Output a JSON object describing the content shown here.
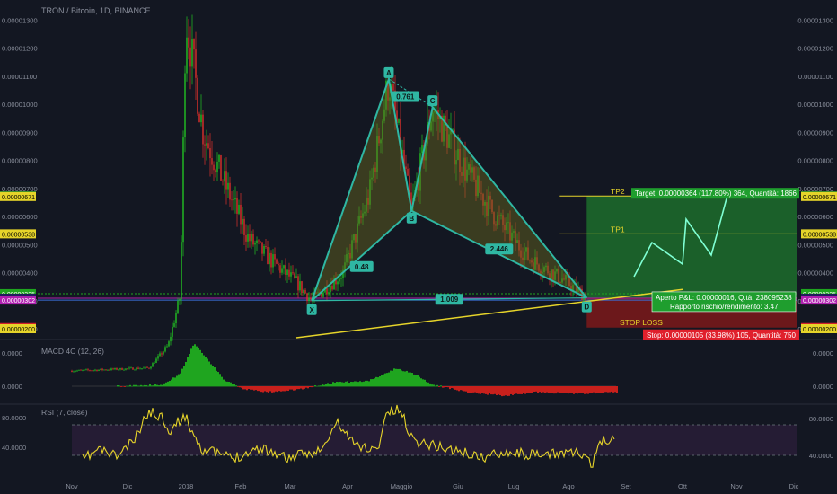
{
  "header": {
    "title": "TRON / Bitcoin, 1D, BINANCE"
  },
  "colors": {
    "bg": "#131722",
    "up": "#26a69a",
    "upBright": "#22c322",
    "down": "#e0312b",
    "pattern": "#2fb7a3",
    "patternFill": "#6b6b1e",
    "trend": "#e6d42a",
    "macdUp": "#1fa51f",
    "macdDown": "#c8201c",
    "rsi": "#e6d42a",
    "target": "#1f7a2e",
    "stop": "#8b1a1a"
  },
  "price_axis": {
    "labels": [
      "0.00001300",
      "0.00001200",
      "0.00001100",
      "0.00001000",
      "0.00000900",
      "0.00000800",
      "0.00000700",
      "0.00000600",
      "0.00000500",
      "0.00000400",
      "0.00000300",
      "0.00000200"
    ]
  },
  "price_tags": [
    {
      "value": "0.00000673",
      "color": "#1f9e2e",
      "text_color": "#ffffff"
    },
    {
      "value": "0.00000671",
      "color": "#e6d42a",
      "text_color": "#000000"
    },
    {
      "value": "0.00000538",
      "color": "#e6d42a",
      "text_color": "#000000"
    },
    {
      "value": "0.00000325",
      "color": "#1fa51f",
      "text_color": "#ffffff"
    },
    {
      "value": "0.00000309",
      "color": "#1e1e5a",
      "text_color": "#ffffff"
    },
    {
      "value": "0.00000302",
      "color": "#b020b0",
      "text_color": "#ffffff"
    },
    {
      "value": "0.00000204",
      "color": "#d0202c",
      "text_color": "#ffffff"
    },
    {
      "value": "0.00000200",
      "color": "#e6d42a",
      "text_color": "#000000"
    }
  ],
  "time_axis": {
    "labels": [
      "Nov",
      "Dic",
      "2018",
      "Feb",
      "Mar",
      "Apr",
      "Maggio",
      "Giu",
      "Lug",
      "Ago",
      "Set",
      "Ott",
      "Nov",
      "Dic"
    ]
  },
  "pattern_labels": {
    "X": "X",
    "A": "A",
    "B": "B",
    "C": "C",
    "D": "D",
    "xb": "0.48",
    "ac": "0.761",
    "bd": "2.446",
    "xd": "1.009"
  },
  "trade": {
    "tp2": "TP2",
    "tp1": "TP1",
    "stop_loss": "STOP LOSS",
    "target": "Target: 0.00000364 (117.80%) 364, Quantità: 1866",
    "stop": "Stop: 0.00000105 (33.98%) 105, Quantità: 750",
    "pnl": "Aperto P&L: 0.00000016, Q.tà: 238095238",
    "rr": "Rapporto rischio/rendimento: 3.47"
  },
  "macd": {
    "title": "MACD 4C (12, 26)",
    "axis": [
      "0.0000",
      "0.0000"
    ]
  },
  "rsi": {
    "title": "RSI (7, close)",
    "axis": [
      "80.0000",
      "40.0000"
    ]
  },
  "chart_data": {
    "type": "candlestick",
    "title": "TRON / Bitcoin, 1D, BINANCE",
    "harmonic_pattern": {
      "type": "butterfly",
      "points": [
        {
          "label": "X",
          "date": "2018-03-18",
          "price": 3e-06
        },
        {
          "label": "A",
          "date": "2018-05-01",
          "price": 1.09e-05
        },
        {
          "label": "B",
          "date": "2018-05-14",
          "price": 6.2e-06
        },
        {
          "label": "C",
          "date": "2018-05-26",
          "price": 9.9e-06
        },
        {
          "label": "D",
          "date": "2018-08-22",
          "price": 3.1e-06
        }
      ],
      "ratios": {
        "XB": 0.48,
        "AC": 0.761,
        "BD": 2.446,
        "XD": 1.009
      }
    },
    "trade_levels": {
      "TP2": 6.73e-06,
      "TP1": 5.38e-06,
      "entry": 3.09e-06,
      "stop_loss": 2.04e-06
    },
    "close_series": [
      {
        "date": "2017-11-01",
        "price": 5e-07
      },
      {
        "date": "2017-12-15",
        "price": 6e-07
      },
      {
        "date": "2017-12-26",
        "price": 1.4e-06
      },
      {
        "date": "2018-01-02",
        "price": 3.2e-06
      },
      {
        "date": "2018-01-05",
        "price": 1.32e-05
      },
      {
        "date": "2018-01-15",
        "price": 9e-06
      },
      {
        "date": "2018-01-25",
        "price": 7.5e-06
      },
      {
        "date": "2018-02-10",
        "price": 5.2e-06
      },
      {
        "date": "2018-02-25",
        "price": 4.3e-06
      },
      {
        "date": "2018-03-10",
        "price": 3.6e-06
      },
      {
        "date": "2018-03-18",
        "price": 3e-06
      },
      {
        "date": "2018-04-05",
        "price": 4e-06
      },
      {
        "date": "2018-04-20",
        "price": 6.8e-06
      },
      {
        "date": "2018-05-01",
        "price": 1.09e-05
      },
      {
        "date": "2018-05-14",
        "price": 6.2e-06
      },
      {
        "date": "2018-05-26",
        "price": 9.9e-06
      },
      {
        "date": "2018-06-15",
        "price": 7.5e-06
      },
      {
        "date": "2018-07-01",
        "price": 6e-06
      },
      {
        "date": "2018-07-20",
        "price": 4.5e-06
      },
      {
        "date": "2018-08-10",
        "price": 3.7e-06
      },
      {
        "date": "2018-08-22",
        "price": 3.1e-06
      }
    ],
    "rsi_levels": [
      80,
      40
    ]
  }
}
